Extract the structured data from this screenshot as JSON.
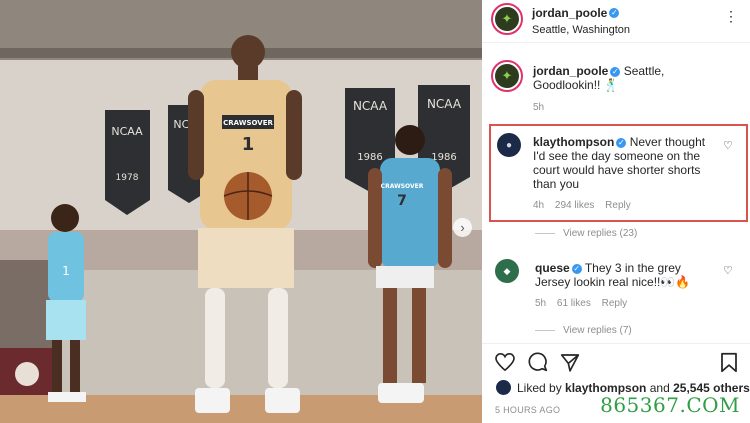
{
  "post": {
    "author": "jordan_poole",
    "location": "Seattle, Washington",
    "more": "⋮"
  },
  "caption": {
    "author": "jordan_poole",
    "text": "Seattle, Goodlookin!! 🕺",
    "time": "5h"
  },
  "comments": [
    {
      "author": "klaythompson",
      "text": "Never thought I'd see the day someone on the court would have shorter shorts than you",
      "time": "4h",
      "likes": "294 likes",
      "reply": "Reply",
      "view_replies": "View replies (23)"
    },
    {
      "author": "quese",
      "text": "They 3 in the grey Jersey lookin real nice!!👀🔥",
      "time": "5h",
      "likes": "61 likes",
      "reply": "Reply",
      "view_replies": "View replies (7)"
    }
  ],
  "liked_by": {
    "prefix": "Liked by ",
    "user": "klaythompson",
    "middle": " and ",
    "others": "25,545 others"
  },
  "timestamp": "5 HOURS AGO",
  "watermark": "865367.COM",
  "photo": {
    "banners": [
      "NCAA",
      "NCAA",
      "NCAA",
      "NCAA"
    ],
    "banner_years": [
      "1978",
      "",
      "1986",
      "1986"
    ],
    "jersey_main_number": "1",
    "jersey_main_brand": "CRAWSOVER",
    "jersey_right_number": "7",
    "jersey_right_brand": "CRAWSOVER",
    "jersey_left_number": "1"
  },
  "colors": {
    "accent": "#3897f0",
    "highlight": "#d9534f",
    "ring": "#e1306c"
  }
}
